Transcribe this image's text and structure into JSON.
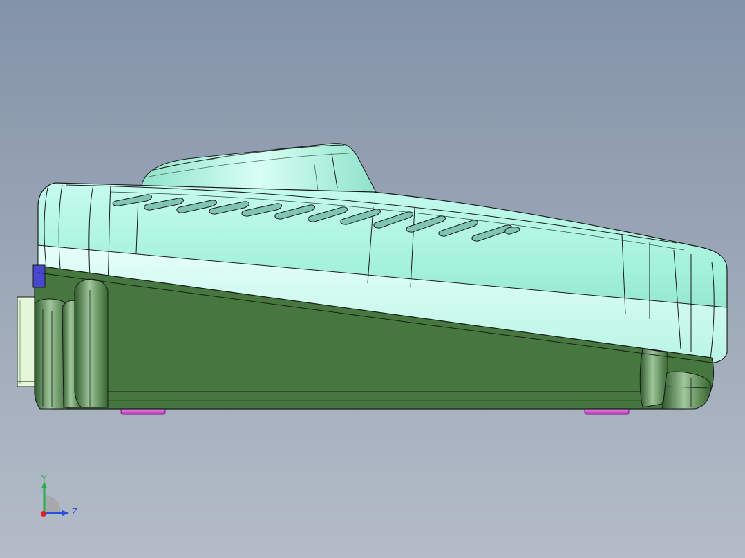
{
  "viewport": {
    "background_top": "#8393a8",
    "background_bottom": "#b4bcc8"
  },
  "model": {
    "upper_body_color": "#a8f5de",
    "lower_body_color": "#46773f",
    "outline_color": "#1a1a1a",
    "feet_color": "#d24fd2",
    "accent_color": "#4040c8",
    "vent_slot_count": 13
  },
  "triad": {
    "y_label": "Y",
    "z_label": "Z",
    "y_color": "#22b14c",
    "z_color": "#2850e0",
    "x_color": "#e02020"
  }
}
